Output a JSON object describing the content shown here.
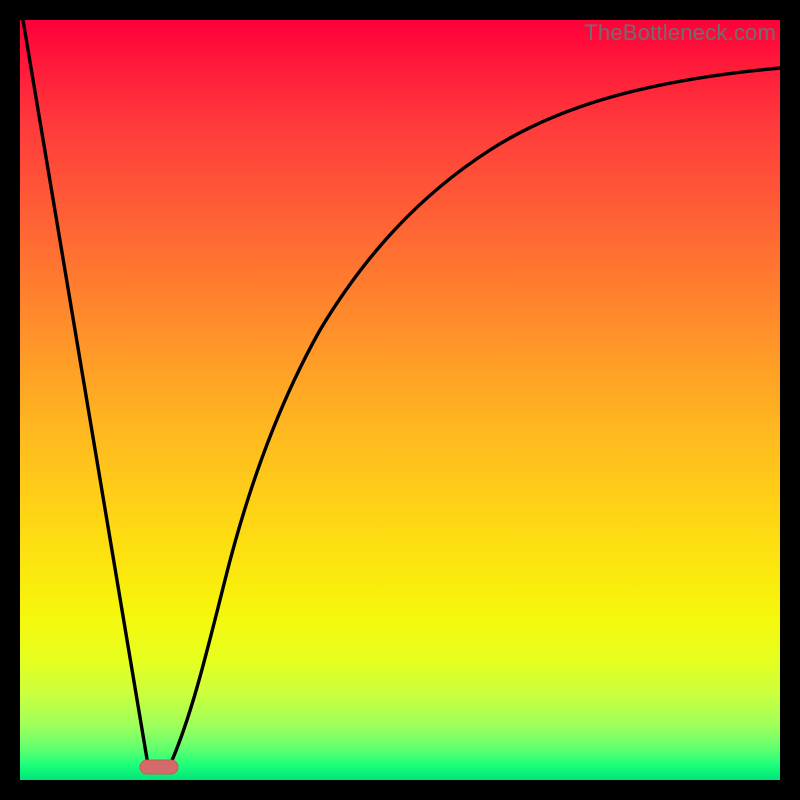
{
  "watermark": "TheBottleneck.com",
  "colors": {
    "frame": "#000000",
    "curve": "#000000",
    "marker_fill": "#d46a6a",
    "marker_stroke": "#c45a5a"
  },
  "chart_data": {
    "type": "line",
    "title": "",
    "xlabel": "",
    "ylabel": "",
    "xlim": [
      0,
      100
    ],
    "ylim": [
      0,
      100
    ],
    "grid": false,
    "legend": false,
    "series": [
      {
        "name": "left-branch",
        "x": [
          0,
          16.5
        ],
        "y": [
          100,
          2
        ],
        "note": "straight descending segment from top-left to valley"
      },
      {
        "name": "right-branch",
        "x": [
          20,
          24,
          28,
          33,
          38,
          44,
          51,
          60,
          70,
          82,
          100
        ],
        "y": [
          2,
          16,
          30,
          44,
          56,
          66,
          74,
          81,
          86,
          90,
          93
        ],
        "note": "saturating ascending curve from valley up to near top-right"
      }
    ],
    "annotations": [
      {
        "name": "valley-marker",
        "shape": "pill",
        "x": 18,
        "y": 1.5,
        "width_pct": 4,
        "height_pct": 1.6
      }
    ]
  }
}
